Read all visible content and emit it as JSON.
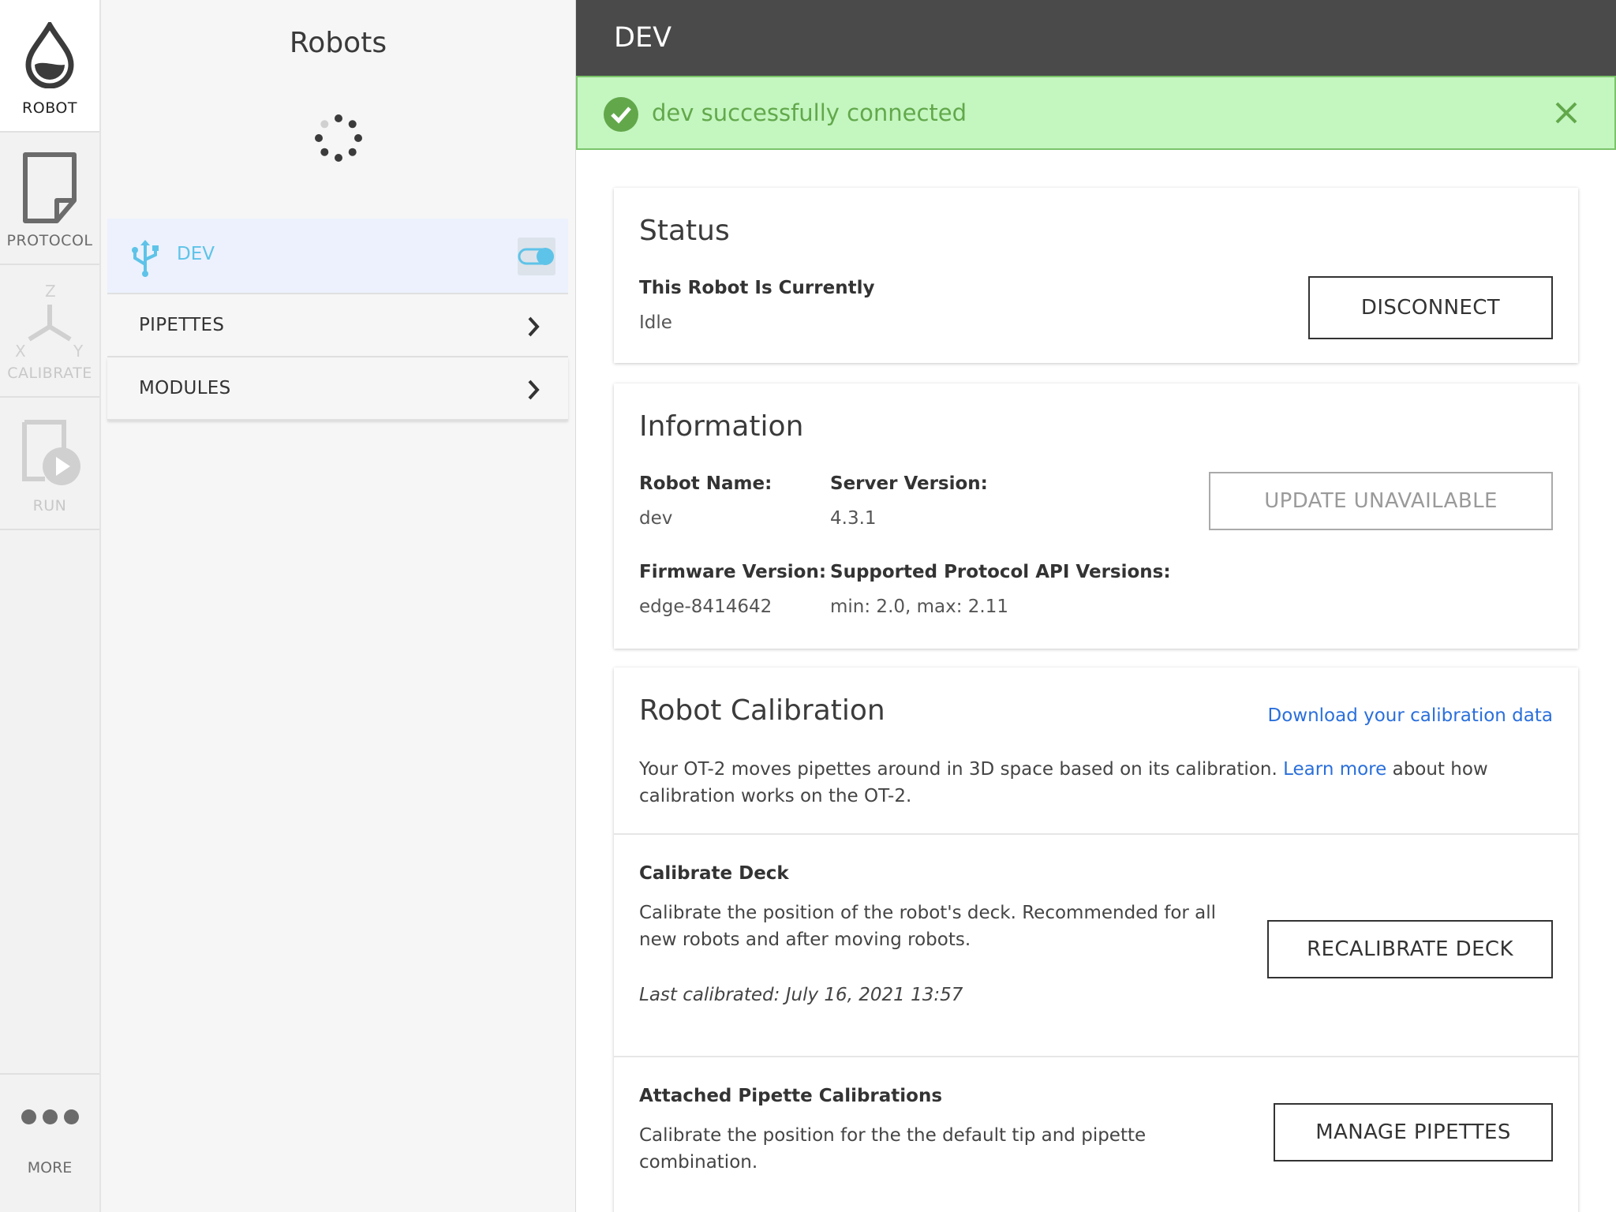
{
  "nav": {
    "robot": "ROBOT",
    "protocol": "PROTOCOL",
    "calibrate": "CALIBRATE",
    "run": "RUN",
    "more": "MORE",
    "axis_z": "Z",
    "axis_x": "X",
    "axis_y": "Y"
  },
  "robots_panel": {
    "title": "Robots",
    "robot": {
      "name": "DEV",
      "connected": true
    },
    "items": [
      {
        "label": "PIPETTES"
      },
      {
        "label": "MODULES"
      }
    ]
  },
  "header": {
    "title": "DEV"
  },
  "alert": {
    "message": "dev successfully connected"
  },
  "status_card": {
    "title": "Status",
    "label": "This Robot Is Currently",
    "value": "Idle",
    "button": "DISCONNECT"
  },
  "info_card": {
    "title": "Information",
    "robot_name_label": "Robot Name:",
    "robot_name": "dev",
    "server_version_label": "Server Version:",
    "server_version": "4.3.1",
    "firmware_version_label": "Firmware Version:",
    "firmware_version": "edge-8414642",
    "api_versions_label": "Supported Protocol API Versions:",
    "api_versions": "min: 2.0, max: 2.11",
    "button": "UPDATE UNAVAILABLE"
  },
  "calibration_card": {
    "title": "Robot Calibration",
    "download_link": "Download your calibration data",
    "intro_text_1": "Your OT-2 moves pipettes around in 3D space based on its calibration.",
    "learn_more": "Learn more",
    "intro_text_2": "about how",
    "intro_text_3": "calibration works on the OT-2.",
    "deck": {
      "title": "Calibrate Deck",
      "desc_1": "Calibrate the position of the robot's deck. Recommended for all",
      "desc_2": "new robots and after moving robots.",
      "last_calibrated": "Last calibrated: July 16, 2021 13:57",
      "button": "RECALIBRATE DECK"
    },
    "pipettes": {
      "title": "Attached Pipette Calibrations",
      "desc_1": "Calibrate the position for the the default tip and pipette",
      "desc_2": "combination.",
      "button": "MANAGE PIPETTES"
    }
  },
  "colors": {
    "header_bg": "#4a4a4a",
    "alert_bg": "#c4f6c0",
    "alert_text": "#62a84b",
    "link": "#2a6fdb",
    "robot_accent": "#5ec3e8",
    "selected_bg": "#ecf1fd"
  }
}
